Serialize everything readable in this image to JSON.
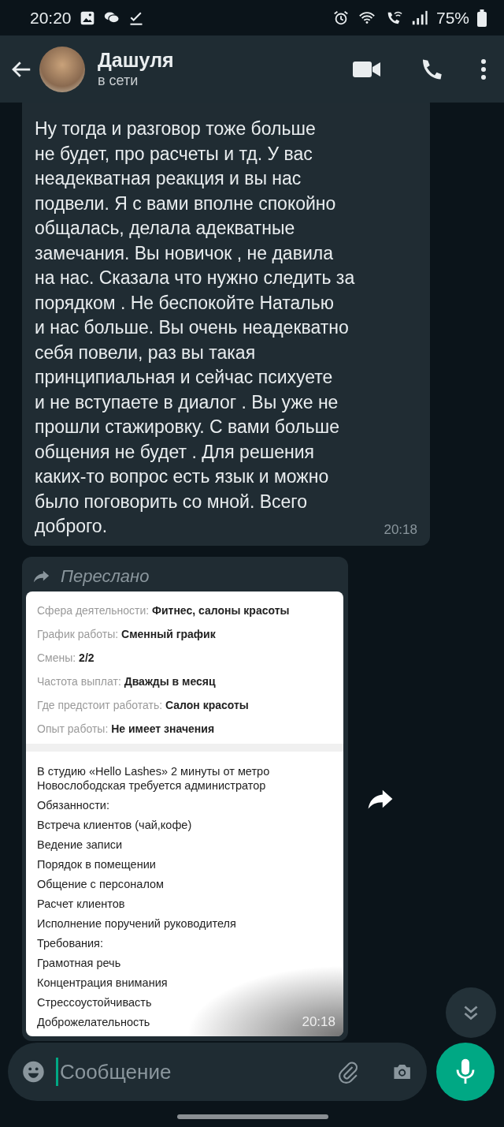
{
  "status_bar": {
    "time": "20:20",
    "battery": "75%"
  },
  "header": {
    "name": "Дашуля",
    "status": "в сети"
  },
  "messages": [
    {
      "kind": "text",
      "text": "Ну тогда и разговор тоже больше\nне будет, про расчеты и тд. У вас\nнеадекватная реакция и вы нас\nподвели. Я с вами вполне спокойно\nобщалась, делала адекватные\nзамечания. Вы новичок , не давила\nна нас. Сказала что нужно следить за\nпорядком . Не беспокойте Наталью\nи нас больше. Вы очень неадекватно\nсебя повели, раз вы такая\nпринципиальная и сейчас психуете\nи не вступаете в диалог . Вы уже не\nпрошли стажировку. С вами больше\nобщения не будет .  Для решения\nкаких-то вопрос есть язык и можно\nбыло поговорить со мной. Всего\nдоброго.",
      "time": "20:18"
    },
    {
      "kind": "forwarded_image",
      "forwarded_label": "Переслано",
      "time": "20:18",
      "document": {
        "fields": [
          {
            "label": "Сфера деятельности:",
            "value": "Фитнес, салоны красоты"
          },
          {
            "label": "График работы:",
            "value": "Сменный график"
          },
          {
            "label": "Смены:",
            "value": "2/2"
          },
          {
            "label": "Частота выплат:",
            "value": "Дважды в месяц"
          },
          {
            "label": "Где предстоит работать:",
            "value": "Салон красоты"
          },
          {
            "label": "Опыт работы:",
            "value": "Не имеет значения"
          }
        ],
        "description": [
          "В студию «Hello Lashes» 2 минуты от метро\nНовослободская требуется администратор",
          "Обязанности:",
          "Встреча клиентов (чай,кофе)",
          "Ведение записи",
          "Порядок в помещении",
          "Общение с персоналом",
          "Расчет клиентов",
          "Исполнение поручений руководителя",
          "Требования:",
          "Грамотная речь",
          "Концентрация внимания",
          "Стрессоустойчивасть",
          "Доброжелательность"
        ]
      }
    }
  ],
  "composer": {
    "placeholder": "Сообщение"
  }
}
